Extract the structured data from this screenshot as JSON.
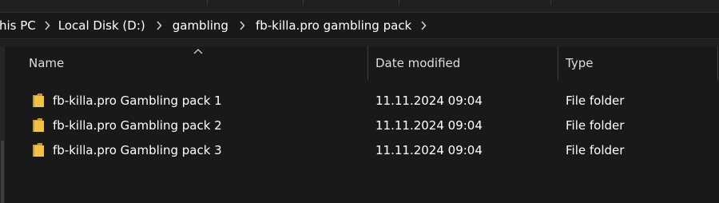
{
  "breadcrumb": {
    "items": [
      {
        "label": "his PC"
      },
      {
        "label": "Local Disk (D:)"
      },
      {
        "label": "gambling"
      },
      {
        "label": "fb-killa.pro gambling pack"
      }
    ]
  },
  "columns": {
    "name": "Name",
    "date_modified": "Date modified",
    "type": "Type"
  },
  "files": [
    {
      "name": "fb-killa.pro Gambling pack 1",
      "date": "11.11.2024 09:04",
      "type": "File folder",
      "icon": "folder-icon"
    },
    {
      "name": "fb-killa.pro Gambling pack 2",
      "date": "11.11.2024 09:04",
      "type": "File folder",
      "icon": "folder-icon"
    },
    {
      "name": "fb-killa.pro Gambling pack 3",
      "date": "11.11.2024 09:04",
      "type": "File folder",
      "icon": "folder-icon"
    }
  ],
  "colors": {
    "background": "#191919",
    "folder": "#e8b93a",
    "text": "#ffffff"
  }
}
